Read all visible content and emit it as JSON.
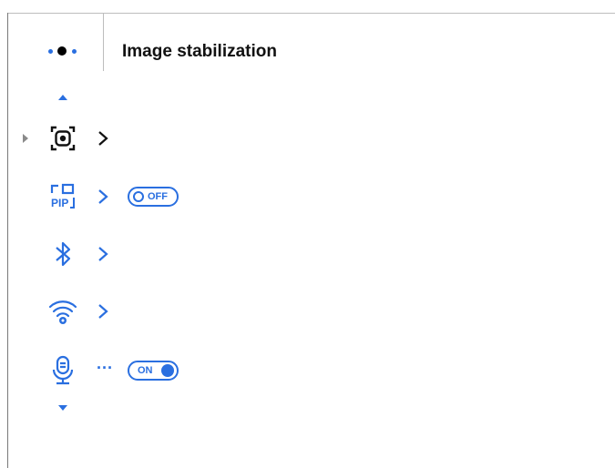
{
  "header": {
    "title": "Image stabilization"
  },
  "menu": {
    "items": [
      {
        "icon": "stabilization-icon",
        "has_toggle": false,
        "selected": true
      },
      {
        "icon": "pip-icon",
        "toggle_label": "OFF",
        "toggle_state": "off"
      },
      {
        "icon": "bluetooth-icon",
        "has_toggle": false
      },
      {
        "icon": "wifi-settings-icon",
        "has_toggle": false
      },
      {
        "icon": "microphone-icon",
        "toggle_label": "ON",
        "toggle_state": "on",
        "more_indicator": "···"
      }
    ]
  },
  "colors": {
    "accent": "#2a6fe0",
    "text": "#111111",
    "divider": "#bdbdbd"
  }
}
